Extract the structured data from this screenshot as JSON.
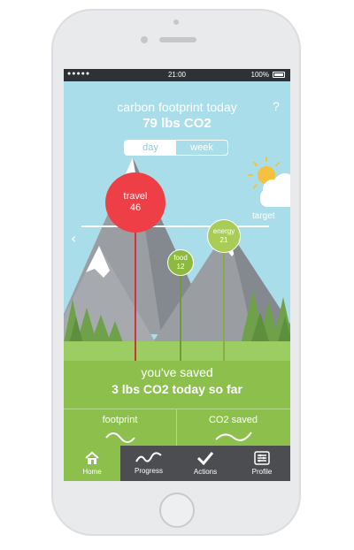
{
  "status_bar": {
    "time": "21:00",
    "battery": "100%"
  },
  "header": {
    "title": "carbon footprint today",
    "value": "79 lbs CO2",
    "help": "?"
  },
  "toggle": {
    "day": "day",
    "week": "week",
    "selected": "day"
  },
  "chart": {
    "target_label": "target",
    "categories": [
      {
        "name": "travel",
        "value": "46",
        "color": "#ef3f46"
      },
      {
        "name": "food",
        "value": "12",
        "color": "#8cba3f"
      },
      {
        "name": "energy",
        "value": "21",
        "color": "#a8cc55"
      }
    ]
  },
  "saved": {
    "line1": "you've saved",
    "line2": "3 lbs CO2 today so far"
  },
  "cards": [
    {
      "label": "footprint"
    },
    {
      "label": "CO2 saved"
    }
  ],
  "tabs": [
    {
      "label": "Home",
      "icon": "home-icon",
      "active": true
    },
    {
      "label": "Progress",
      "icon": "progress-icon",
      "active": false
    },
    {
      "label": "Actions",
      "icon": "check-icon",
      "active": false
    },
    {
      "label": "Profile",
      "icon": "profile-icon",
      "active": false
    }
  ],
  "colors": {
    "sky": "#a9dde9",
    "accent_green": "#8dbf4d",
    "travel_red": "#ef3f46",
    "tabbar": "#4b4d50"
  }
}
